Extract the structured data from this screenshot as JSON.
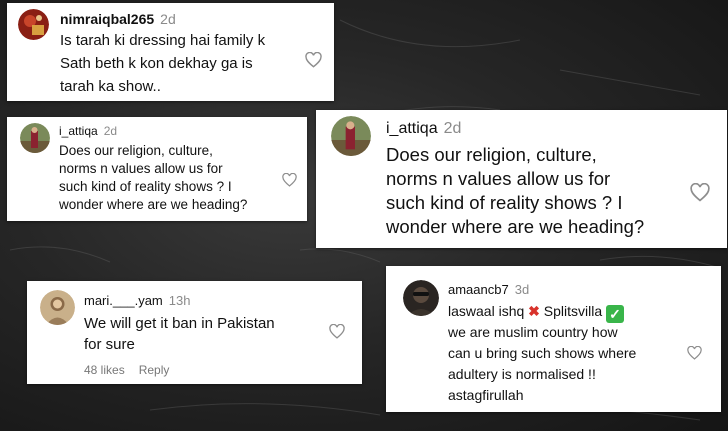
{
  "comments": [
    {
      "username": "nimraiqbal265",
      "time": "2d",
      "text": "Is tarah ki dressing hai family k\nSath beth k kon dekhay ga is\ntarah ka show.."
    },
    {
      "username": "i_attiqa",
      "time": "2d",
      "text": "Does our religion, culture,\nnorms n values allow us for\nsuch kind of reality shows ? I\nwonder where are we heading?"
    },
    {
      "username": "i_attiqa",
      "time": "2d",
      "text": "Does our religion, culture,\nnorms n values allow us for\nsuch kind of reality shows ? I\nwonder where are we heading?"
    },
    {
      "username": "mari.___.yam",
      "time": "13h",
      "text": "We will get it ban in Pakistan\nfor sure",
      "likes": "48 likes",
      "reply": "Reply"
    },
    {
      "username": "amaancb7",
      "time": "3d",
      "line1_a": "laswaal ishq",
      "emoji_x": "✖",
      "line1_b": "Splitsvilla",
      "emoji_check": "✓",
      "text": "we are muslim country how\ncan u bring such shows where\nadultery is normalised !!\nastagfirullah"
    }
  ],
  "icons": {
    "like": "heart-outline-icon"
  }
}
